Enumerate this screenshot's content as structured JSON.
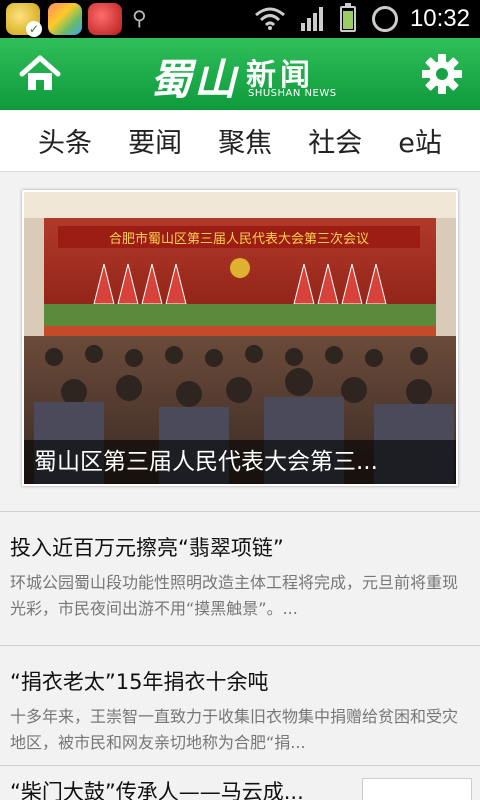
{
  "status_bar": {
    "time": "10:32",
    "icons": [
      "app-coin-icon",
      "app-colorful-icon",
      "app-medical-icon",
      "usb-icon",
      "wifi-icon",
      "signal-icon",
      "battery-icon",
      "alarm-icon"
    ]
  },
  "app_bar": {
    "logo_main": "蜀山",
    "logo_sub": "新闻",
    "logo_en": "SHUSHAN NEWS",
    "home_icon": "home-icon",
    "settings_icon": "gear-icon",
    "color": "#1aaa48"
  },
  "tabs": [
    "头条",
    "要闻",
    "聚焦",
    "社会",
    "e站"
  ],
  "featured": {
    "banner_text": "合肥市蜀山区第三届人民代表大会第三次会议",
    "caption": "蜀山区第三届人民代表大会第三..."
  },
  "news": [
    {
      "title": "投入近百万元擦亮“翡翠项链”",
      "desc": "环城公园蜀山段功能性照明改造主体工程将完成，元旦前将重现光彩，市民夜间出游不用“摸黑触景”。..."
    },
    {
      "title": "“捐衣老太”15年捐衣十余吨",
      "desc": "十多年来，王崇智一直致力于收集旧衣物集中捐赠给贫困和受灾地区，被市民和网友亲切地称为合肥“捐..."
    },
    {
      "title": "“柴门大鼓”传承人——马云成..."
    }
  ]
}
